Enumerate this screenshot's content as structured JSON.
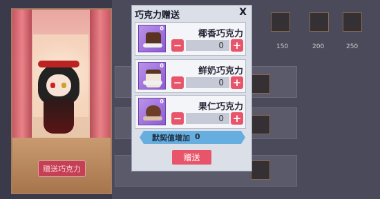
{
  "dialog": {
    "title": "巧克力赠送",
    "close_label": "X",
    "send_label": "赠送"
  },
  "items": [
    {
      "name": "椰香巧克力",
      "quantity": "0",
      "badge": "0",
      "minus": "−",
      "plus": "+"
    },
    {
      "name": "鲜奶巧克力",
      "quantity": "0",
      "badge": "0",
      "minus": "−",
      "plus": "+"
    },
    {
      "name": "果仁巧克力",
      "quantity": "0",
      "badge": "0",
      "minus": "−",
      "plus": "+"
    }
  ],
  "bond": {
    "label": "默契值增加",
    "value": "0"
  },
  "background": {
    "gift_button_label": "赠送巧克力",
    "reward_numbers": [
      "150",
      "200",
      "250"
    ]
  },
  "colors": {
    "accent": "#e8556a",
    "bond_bar": "#67aee0",
    "dialog_bg": "#dadfe8"
  }
}
